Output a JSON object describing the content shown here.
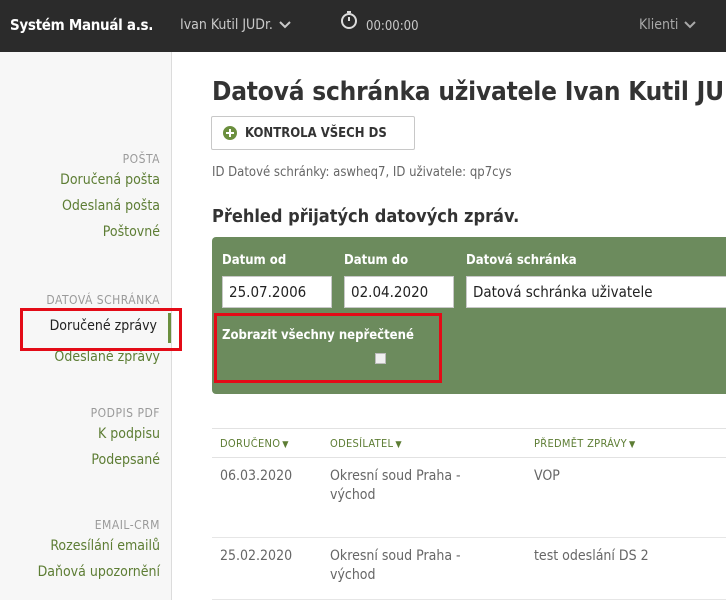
{
  "topbar": {
    "brand": "Systém Manuál a.s.",
    "user": "Ivan Kutil JUDr.",
    "timer": "00:00:00",
    "clients": "Klienti"
  },
  "sidebar": {
    "sections": [
      {
        "heading": "POŠTA",
        "items": [
          "Doručená pošta",
          "Odeslaná pošta",
          "Poštovné"
        ]
      },
      {
        "heading": "DATOVÁ SCHRÁNKA",
        "active": "Doručené zprávy",
        "items": [
          "Odeslané zprávy"
        ]
      },
      {
        "heading": "PODPIS PDF",
        "items": [
          "K podpisu",
          "Podepsané"
        ]
      },
      {
        "heading": "EMAIL-CRM",
        "items": [
          "Rozesílání emailů",
          "Daňová upozornění"
        ]
      }
    ]
  },
  "main": {
    "title": "Datová schránka uživatele Ivan Kutil JUDr.",
    "check_button": "KONTROLA VŠECH DS",
    "id_line": "ID Datové schránky: aswheq7, ID uživatele: qp7cys",
    "section_title": "Přehled přijatých datových zpráv."
  },
  "filter": {
    "date_from_label": "Datum od",
    "date_from_value": "25.07.2006",
    "date_to_label": "Datum do",
    "date_to_value": "02.04.2020",
    "mailbox_label": "Datová schránka",
    "mailbox_value": "Datová schránka uživatele",
    "unread_label": "Zobrazit všechny nepřečtené",
    "unread_checked": false
  },
  "table": {
    "columns": [
      "DORUČENO",
      "ODESÍLATEL",
      "PŘEDMĚT ZPRÁVY"
    ],
    "rows": [
      {
        "date": "06.03.2020",
        "sender": "Okresní soud Praha - východ",
        "subject": "VOP"
      },
      {
        "date": "25.02.2020",
        "sender": "Okresní soud Praha - východ",
        "subject": "test odeslání DS 2"
      }
    ]
  },
  "colors": {
    "topbar": "#2b2b2b",
    "accent_green": "#6b8f3e",
    "panel_green": "#6c8b5d",
    "highlight_red": "#e30b17"
  }
}
